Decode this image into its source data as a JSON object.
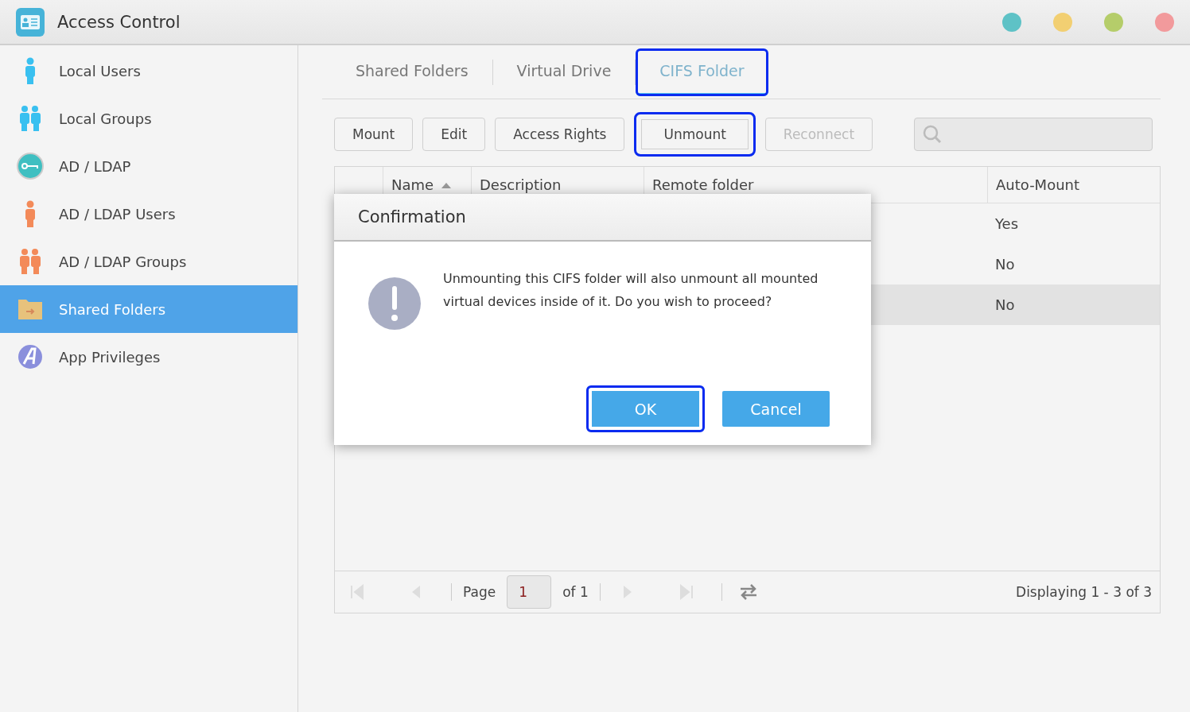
{
  "window": {
    "title": "Access Control",
    "buttons": [
      {
        "color": "#5ec2c6"
      },
      {
        "color": "#f2cf72"
      },
      {
        "color": "#b5cd6a"
      },
      {
        "color": "#f29a9c"
      }
    ]
  },
  "sidebar": {
    "items": [
      {
        "label": "Local Users",
        "kind": "local-user",
        "selected": false
      },
      {
        "label": "Local Groups",
        "kind": "local-group",
        "selected": false
      },
      {
        "label": "AD / LDAP",
        "kind": "ldap",
        "selected": false
      },
      {
        "label": "AD / LDAP Users",
        "kind": "ldap-user",
        "selected": false
      },
      {
        "label": "AD / LDAP Groups",
        "kind": "ldap-group",
        "selected": false
      },
      {
        "label": "Shared Folders",
        "kind": "folder",
        "selected": true
      },
      {
        "label": "App Privileges",
        "kind": "app",
        "selected": false
      }
    ]
  },
  "tabs": [
    {
      "label": "Shared Folders",
      "selected": false,
      "highlighted": false
    },
    {
      "label": "Virtual Drive",
      "selected": false,
      "highlighted": false
    },
    {
      "label": "CIFS Folder",
      "selected": true,
      "highlighted": true
    }
  ],
  "toolbar": {
    "buttons": [
      {
        "label": "Mount",
        "disabled": false,
        "highlighted": false
      },
      {
        "label": "Edit",
        "disabled": false,
        "highlighted": false
      },
      {
        "label": "Access Rights",
        "disabled": false,
        "highlighted": false
      },
      {
        "label": "Unmount",
        "disabled": false,
        "highlighted": true
      },
      {
        "label": "Reconnect",
        "disabled": true,
        "highlighted": false
      }
    ]
  },
  "table": {
    "columns": [
      {
        "label": "Name",
        "sorted": true
      },
      {
        "label": "Description",
        "sorted": false
      },
      {
        "label": "Remote folder",
        "sorted": false
      },
      {
        "label": "Auto-Mount",
        "sorted": false
      }
    ],
    "rows": [
      {
        "auto_mount": "Yes",
        "selected": false
      },
      {
        "auto_mount": "No",
        "selected": false
      },
      {
        "auto_mount": "No",
        "selected": true
      }
    ]
  },
  "pager": {
    "page_label": "Page",
    "page": "1",
    "of": "of 1",
    "summary": "Displaying 1 - 3 of 3"
  },
  "dialog": {
    "title": "Confirmation",
    "message": "Unmounting this CIFS folder will also unmount all mounted virtual devices inside of it. Do you wish to proceed?",
    "buttons": [
      {
        "label": "OK",
        "highlighted": true
      },
      {
        "label": "Cancel",
        "highlighted": false
      }
    ]
  }
}
